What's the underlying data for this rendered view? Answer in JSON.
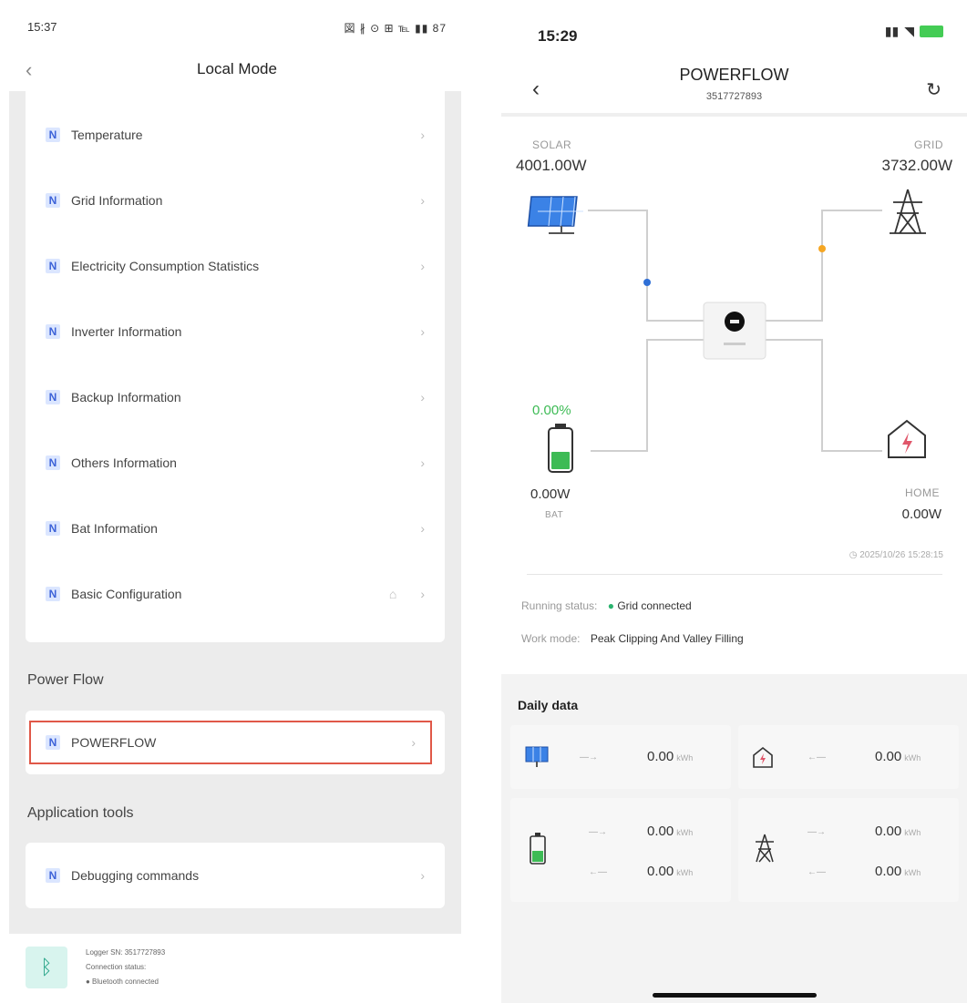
{
  "left": {
    "status_time": "15:37",
    "status_icons": "図 ∦ ⊙ ⊞ ℡ ▮▮ 87 ",
    "header_title": "Local Mode",
    "back_glyph": "‹",
    "menu_items": [
      {
        "label": "Temperature"
      },
      {
        "label": "Grid Information"
      },
      {
        "label": "Electricity Consumption Statistics"
      },
      {
        "label": "Inverter Information"
      },
      {
        "label": "Backup Information"
      },
      {
        "label": "Others Information"
      },
      {
        "label": "Bat Information"
      },
      {
        "label": "Basic Configuration"
      }
    ],
    "power_flow_section": "Power Flow",
    "powerflow_item": "POWERFLOW",
    "app_tools_section": "Application tools",
    "debug_item": "Debugging commands",
    "logger_sn": "Logger SN: 3517727893",
    "connection_status": "Connection status:",
    "bluetooth_status": "● Bluetooth connected"
  },
  "right": {
    "status_time": "15:29",
    "title": "POWERFLOW",
    "serial": "3517727893",
    "solar_label": "SOLAR",
    "solar_value": "4001.00W",
    "grid_label": "GRID",
    "grid_value": "3732.00W",
    "battery_soc": "0.00%",
    "battery_value": "0.00W",
    "battery_label": "BAT",
    "home_label": "HOME",
    "home_value": "0.00W",
    "timestamp": "2025/10/26 15:28:15",
    "running_status_label": "Running status:",
    "running_status_value": "Grid connected",
    "work_mode_label": "Work mode:",
    "work_mode_value": "Peak Clipping And Valley Filling",
    "daily_title": "Daily data",
    "daily": {
      "solar_value": "0.00",
      "home_value": "0.00",
      "bat_charge_value": "0.00",
      "bat_discharge_value": "0.00",
      "grid_export_value": "0.00",
      "grid_import_value": "0.00",
      "unit": "kWh"
    },
    "colors": {
      "solar_dot": "#2f6fd6",
      "grid_dot": "#f5a623",
      "battery_green": "#3dbb55",
      "home_red": "#e0566a"
    }
  }
}
